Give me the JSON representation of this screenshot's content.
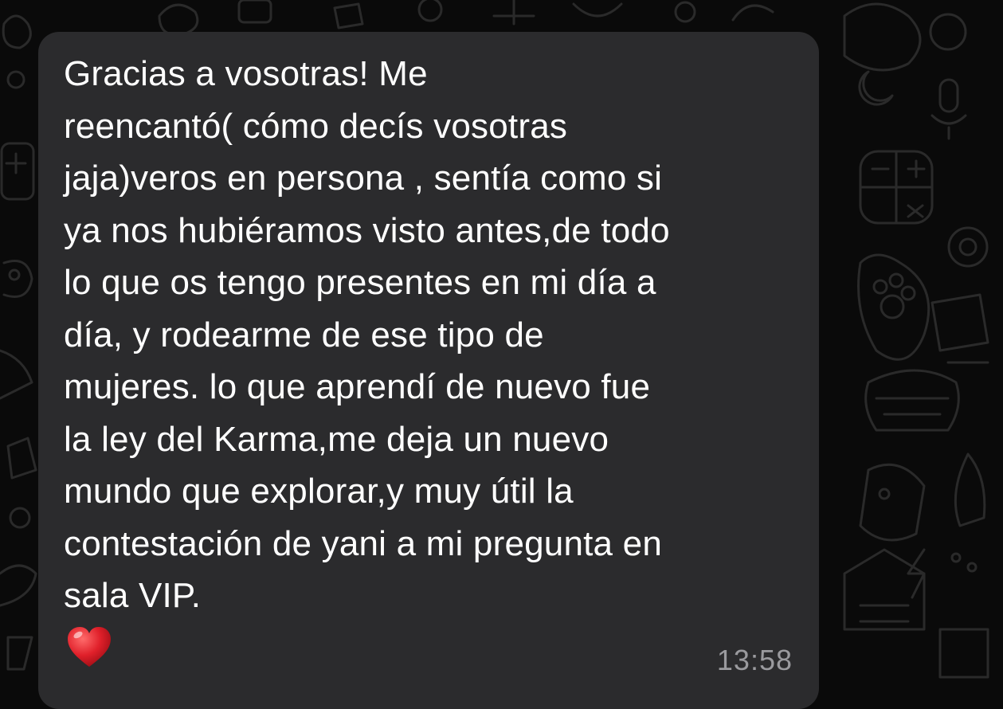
{
  "message": {
    "text": "Gracias a vosotras! Me\nreencantó( cómo decís vosotras\njaja)veros en persona , sentía como si\nya nos hubiéramos visto antes,de todo\nlo que os tengo presentes en mi día a\ndía, y rodearme de ese tipo de\nmujeres. lo que aprendí de nuevo fue\nla ley del Karma,me deja un nuevo\nmundo que explorar,y muy útil la\ncontestación de yani a mi pregunta en\nsala VIP.",
    "emoji": "heart-emoji",
    "time": "13:58"
  },
  "colors": {
    "background": "#0a0a0a",
    "bubble": "#2b2b2d",
    "text": "#ffffff",
    "timestamp": "#9a9a9e",
    "heart": "#e0202a"
  }
}
